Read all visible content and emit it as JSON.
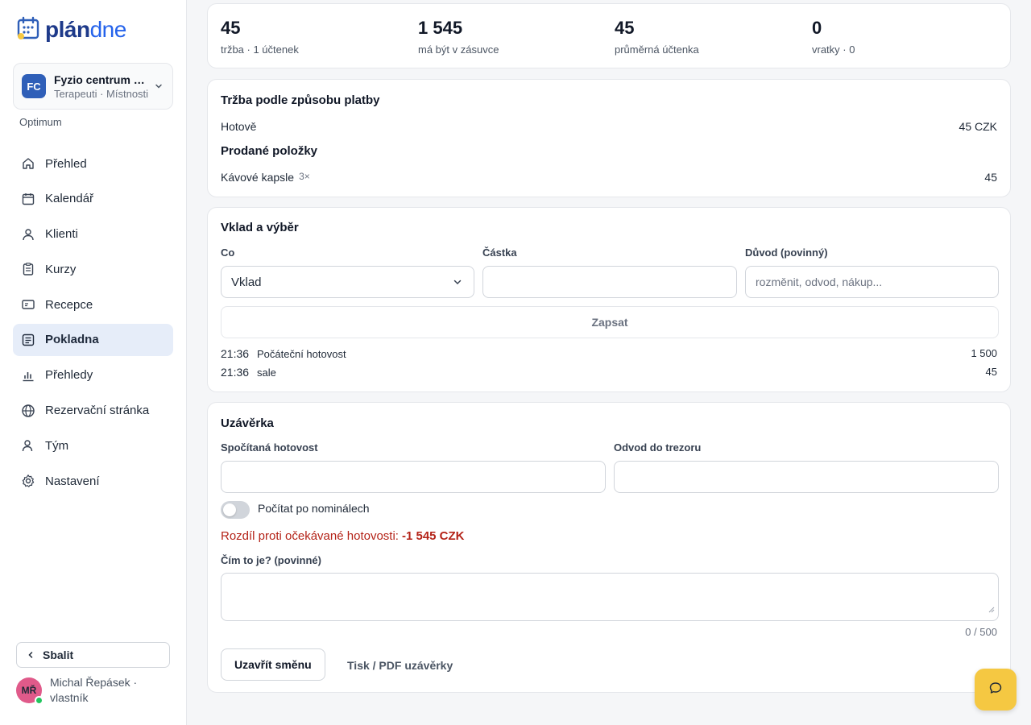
{
  "app": {
    "logo_bold": "plán",
    "logo_light": "dne",
    "brand_color": "#1e3a8a"
  },
  "org": {
    "initials": "FC",
    "name": "Fyzio centrum Pražská",
    "subtitle": "Terapeuti · Místnosti",
    "plan": "Optimum"
  },
  "nav": [
    {
      "label": "Přehled",
      "icon": "home-icon"
    },
    {
      "label": "Kalendář",
      "icon": "calendar-icon"
    },
    {
      "label": "Klienti",
      "icon": "user-icon"
    },
    {
      "label": "Kurzy",
      "icon": "clipboard-icon"
    },
    {
      "label": "Recepce",
      "icon": "id-card-icon"
    },
    {
      "label": "Pokladna",
      "icon": "register-icon",
      "active": true
    },
    {
      "label": "Přehledy",
      "icon": "bar-chart-icon"
    },
    {
      "label": "Rezervační stránka",
      "icon": "globe-icon"
    },
    {
      "label": "Tým",
      "icon": "team-icon"
    },
    {
      "label": "Nastavení",
      "icon": "gear-icon"
    }
  ],
  "sidebar_footer": {
    "collapse_label": "Sbalit",
    "user_initials": "MŘ",
    "user_name": "Michal Řepásek · vlastník"
  },
  "stats": [
    {
      "value": "45",
      "label": "tržba · 1 účtenek"
    },
    {
      "value": "1 545",
      "label": "má být v zásuvce"
    },
    {
      "value": "45",
      "label": "průměrná účtenka"
    },
    {
      "value": "0",
      "label": "vratky · 0"
    }
  ],
  "payments": {
    "title": "Tržba podle způsobu platby",
    "rows": [
      {
        "method": "Hotově",
        "amount": "45 CZK"
      }
    ],
    "items_title": "Prodané položky",
    "items": [
      {
        "name": "Kávové kapsle",
        "qty": "3×",
        "amount": "45"
      }
    ]
  },
  "cash_move": {
    "title": "Vklad a výběr",
    "what_label": "Co",
    "what_value": "Vklad",
    "amount_label": "Částka",
    "amount_value": "",
    "reason_label": "Důvod (povinný)",
    "reason_placeholder": "rozměnit, odvod, nákup...",
    "submit_label": "Zapsat",
    "log": [
      {
        "time": "21:36",
        "desc": "Počáteční hotovost",
        "amount": "1 500"
      },
      {
        "time": "21:36",
        "desc": "sale",
        "amount": "45"
      }
    ]
  },
  "closing": {
    "title": "Uzávěrka",
    "counted_label": "Spočítaná hotovost",
    "counted_value": "",
    "safe_label": "Odvod do trezoru",
    "safe_value": "",
    "toggle_label": "Počítat po nominálech",
    "toggle_on": false,
    "diff_label": "Rozdíl proti očekávané hotovosti:",
    "diff_value": "-1 545 CZK",
    "diff_color": "#b42318",
    "reason_label": "Čím to je? (povinné)",
    "counter": "0 / 500",
    "close_label": "Uzavřít směnu",
    "print_label": "Tisk / PDF uzávěrky"
  }
}
